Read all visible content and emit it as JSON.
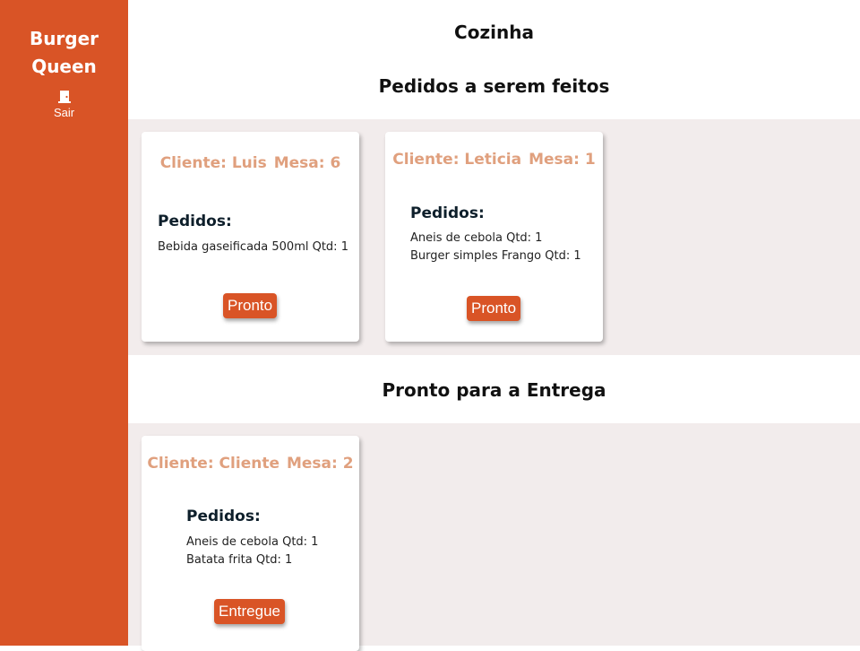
{
  "sidebar": {
    "brand": "Burger Queen",
    "logout_label": "Sair",
    "logout_icon": "door-exit-icon"
  },
  "page_title": "Cozinha",
  "sections": {
    "pending": {
      "title": "Pedidos a serem feitos",
      "cards": [
        {
          "client": "Cliente: Luis",
          "table": "Mesa: 6",
          "orders_title": "Pedidos:",
          "items": [
            "Bebida gaseificada 500ml Qtd: 1"
          ],
          "button": "Pronto"
        },
        {
          "client": "Cliente: Leticia",
          "table": "Mesa: 1",
          "orders_title": "Pedidos:",
          "items": [
            "Aneis de cebola Qtd: 1",
            "Burger simples Frango Qtd: 1"
          ],
          "button": "Pronto"
        }
      ]
    },
    "ready": {
      "title": "Pronto para a Entrega",
      "cards": [
        {
          "client": "Cliente: Cliente",
          "table": "Mesa: 2",
          "orders_title": "Pedidos:",
          "items": [
            "Aneis de cebola Qtd: 1",
            "Batata frita Qtd: 1"
          ],
          "button": "Entregue"
        }
      ]
    }
  },
  "colors": {
    "sidebar": "#d95426",
    "band": "#f2ecec",
    "client_text": "#e0a07e",
    "button": "#d95426"
  }
}
